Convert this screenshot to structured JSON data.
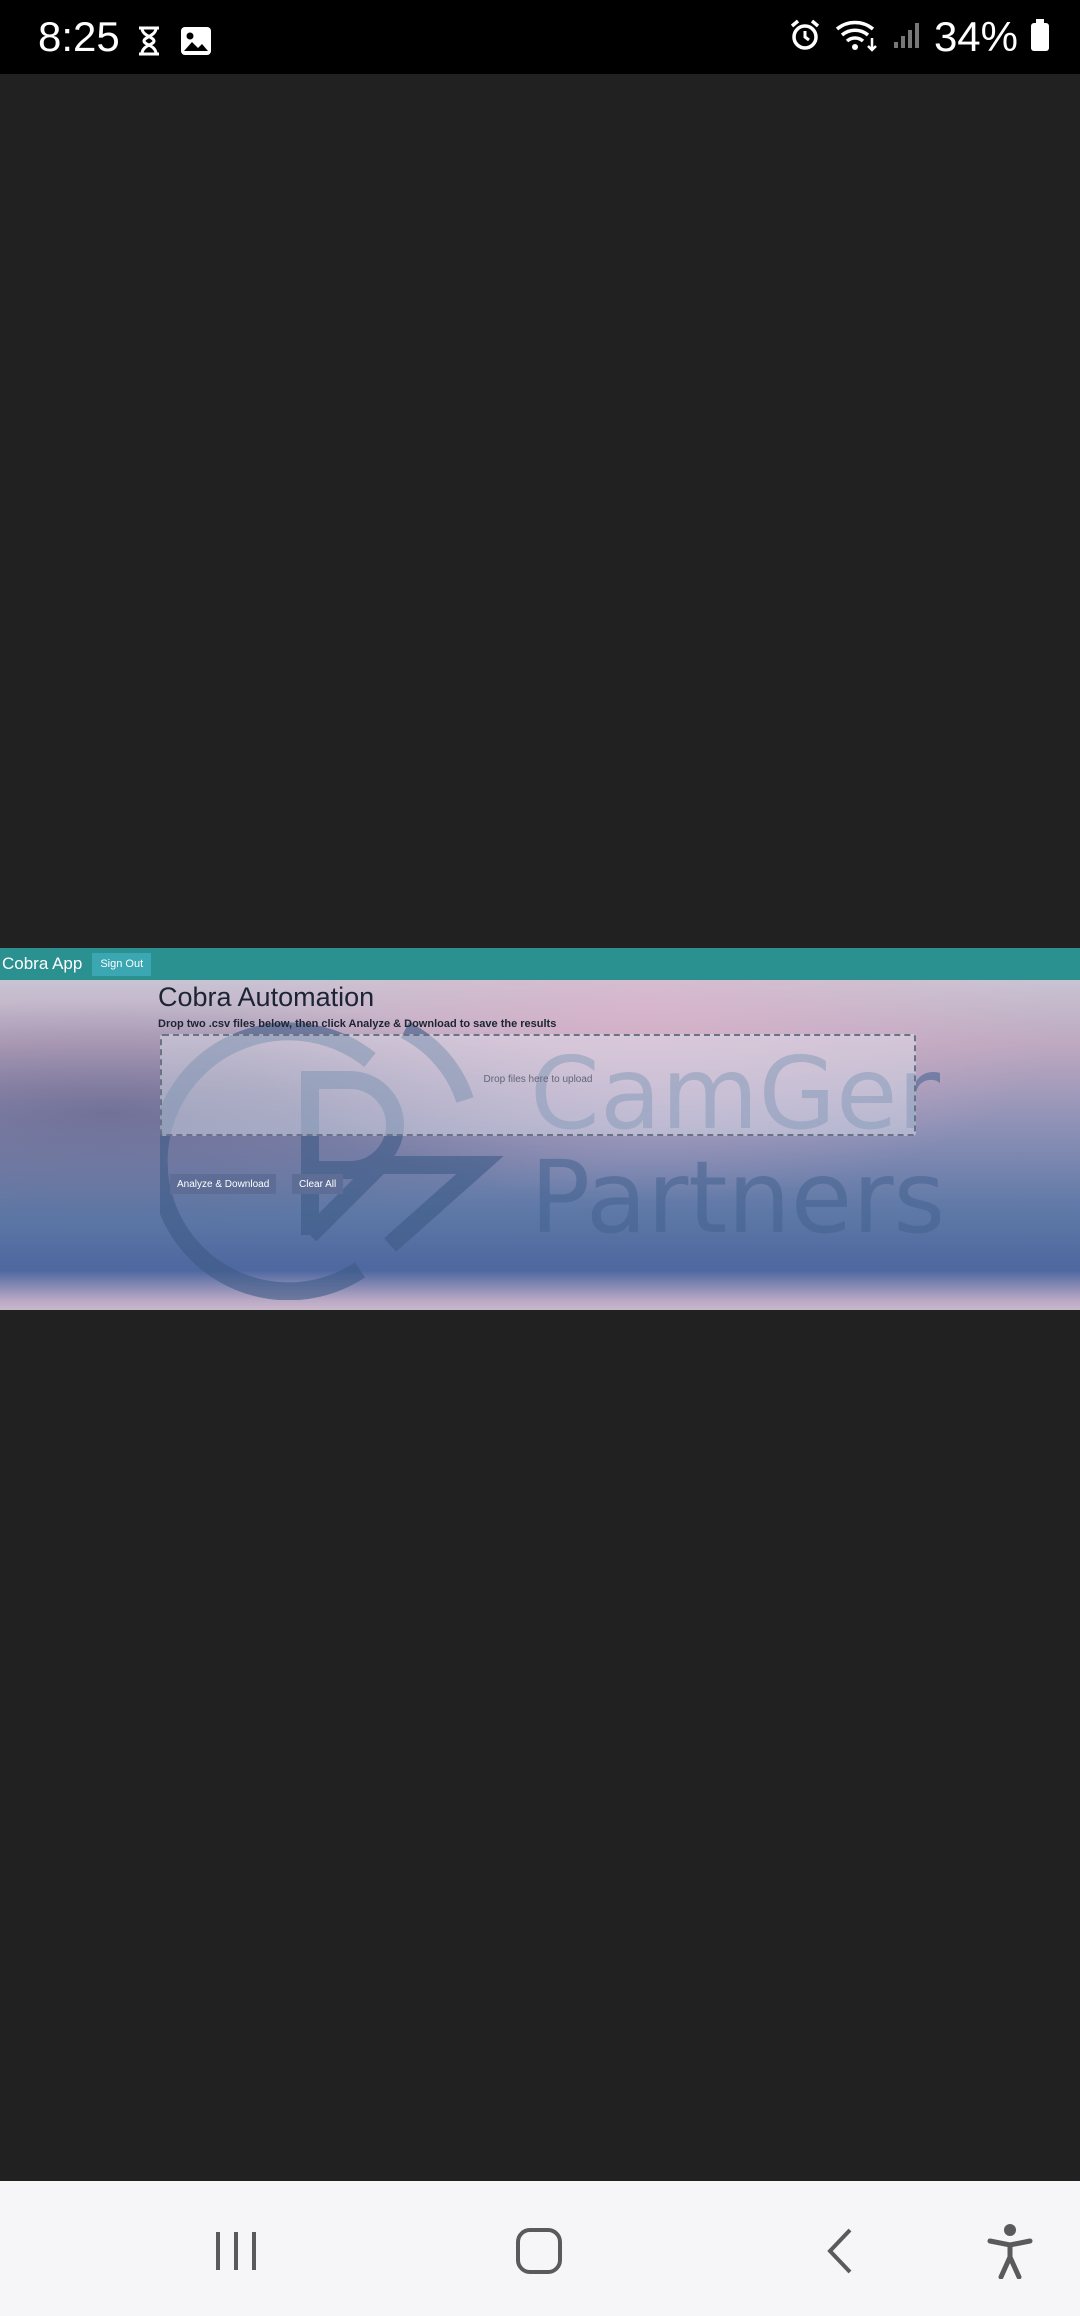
{
  "status_bar": {
    "time": "8:25",
    "battery": "34%"
  },
  "app": {
    "brand": "Cobra App",
    "sign_out": "Sign Out",
    "title": "Cobra Automation",
    "subtitle": "Drop two .csv files below, then click Analyze & Download to save the results",
    "dropzone_text": "Drop files here to upload",
    "analyze_button": "Analyze & Download",
    "clear_button": "Clear All",
    "logo_line1": "CamGen",
    "logo_line2": "Partners"
  },
  "colors": {
    "navbar": "#2a9090",
    "page_bg": "#212121"
  }
}
